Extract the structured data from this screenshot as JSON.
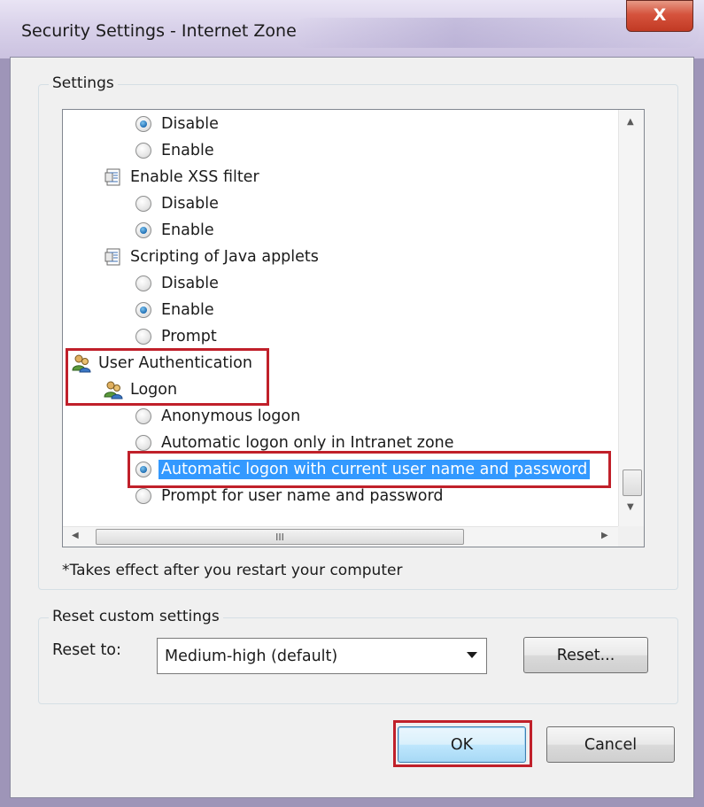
{
  "window": {
    "title": "Security Settings - Internet Zone",
    "close_label": "X"
  },
  "settings_group": {
    "label": "Settings"
  },
  "tree": {
    "items": [
      {
        "type": "radio",
        "label": "Disable",
        "checked": true
      },
      {
        "type": "radio",
        "label": "Enable",
        "checked": false
      },
      {
        "type": "category",
        "label": "Enable XSS filter",
        "icon": "script-icon"
      },
      {
        "type": "radio",
        "label": "Disable",
        "checked": false
      },
      {
        "type": "radio",
        "label": "Enable",
        "checked": true
      },
      {
        "type": "category",
        "label": "Scripting of Java applets",
        "icon": "script-icon"
      },
      {
        "type": "radio",
        "label": "Disable",
        "checked": false
      },
      {
        "type": "radio",
        "label": "Enable",
        "checked": true
      },
      {
        "type": "radio",
        "label": "Prompt",
        "checked": false
      },
      {
        "type": "category",
        "label": "User Authentication",
        "icon": "users-icon"
      },
      {
        "type": "category",
        "label": "Logon",
        "icon": "users-icon"
      },
      {
        "type": "radio",
        "label": "Anonymous logon",
        "checked": false
      },
      {
        "type": "radio",
        "label": "Automatic logon only in Intranet zone",
        "checked": false
      },
      {
        "type": "radio",
        "label": "Automatic logon with current user name and password",
        "checked": true,
        "selected": true
      },
      {
        "type": "radio",
        "label": "Prompt for user name and password",
        "checked": false
      }
    ],
    "hscroll_grip": "III"
  },
  "restart_note": "*Takes effect after you restart your computer",
  "reset_group": {
    "label": "Reset custom settings",
    "reset_to_label": "Reset to:",
    "selected_level": "Medium-high (default)",
    "reset_button": "Reset..."
  },
  "buttons": {
    "ok": "OK",
    "cancel": "Cancel"
  },
  "colors": {
    "highlight": "#3399ff",
    "annotation_red": "#c0202a",
    "radio_checked": "#1f6fb5"
  }
}
